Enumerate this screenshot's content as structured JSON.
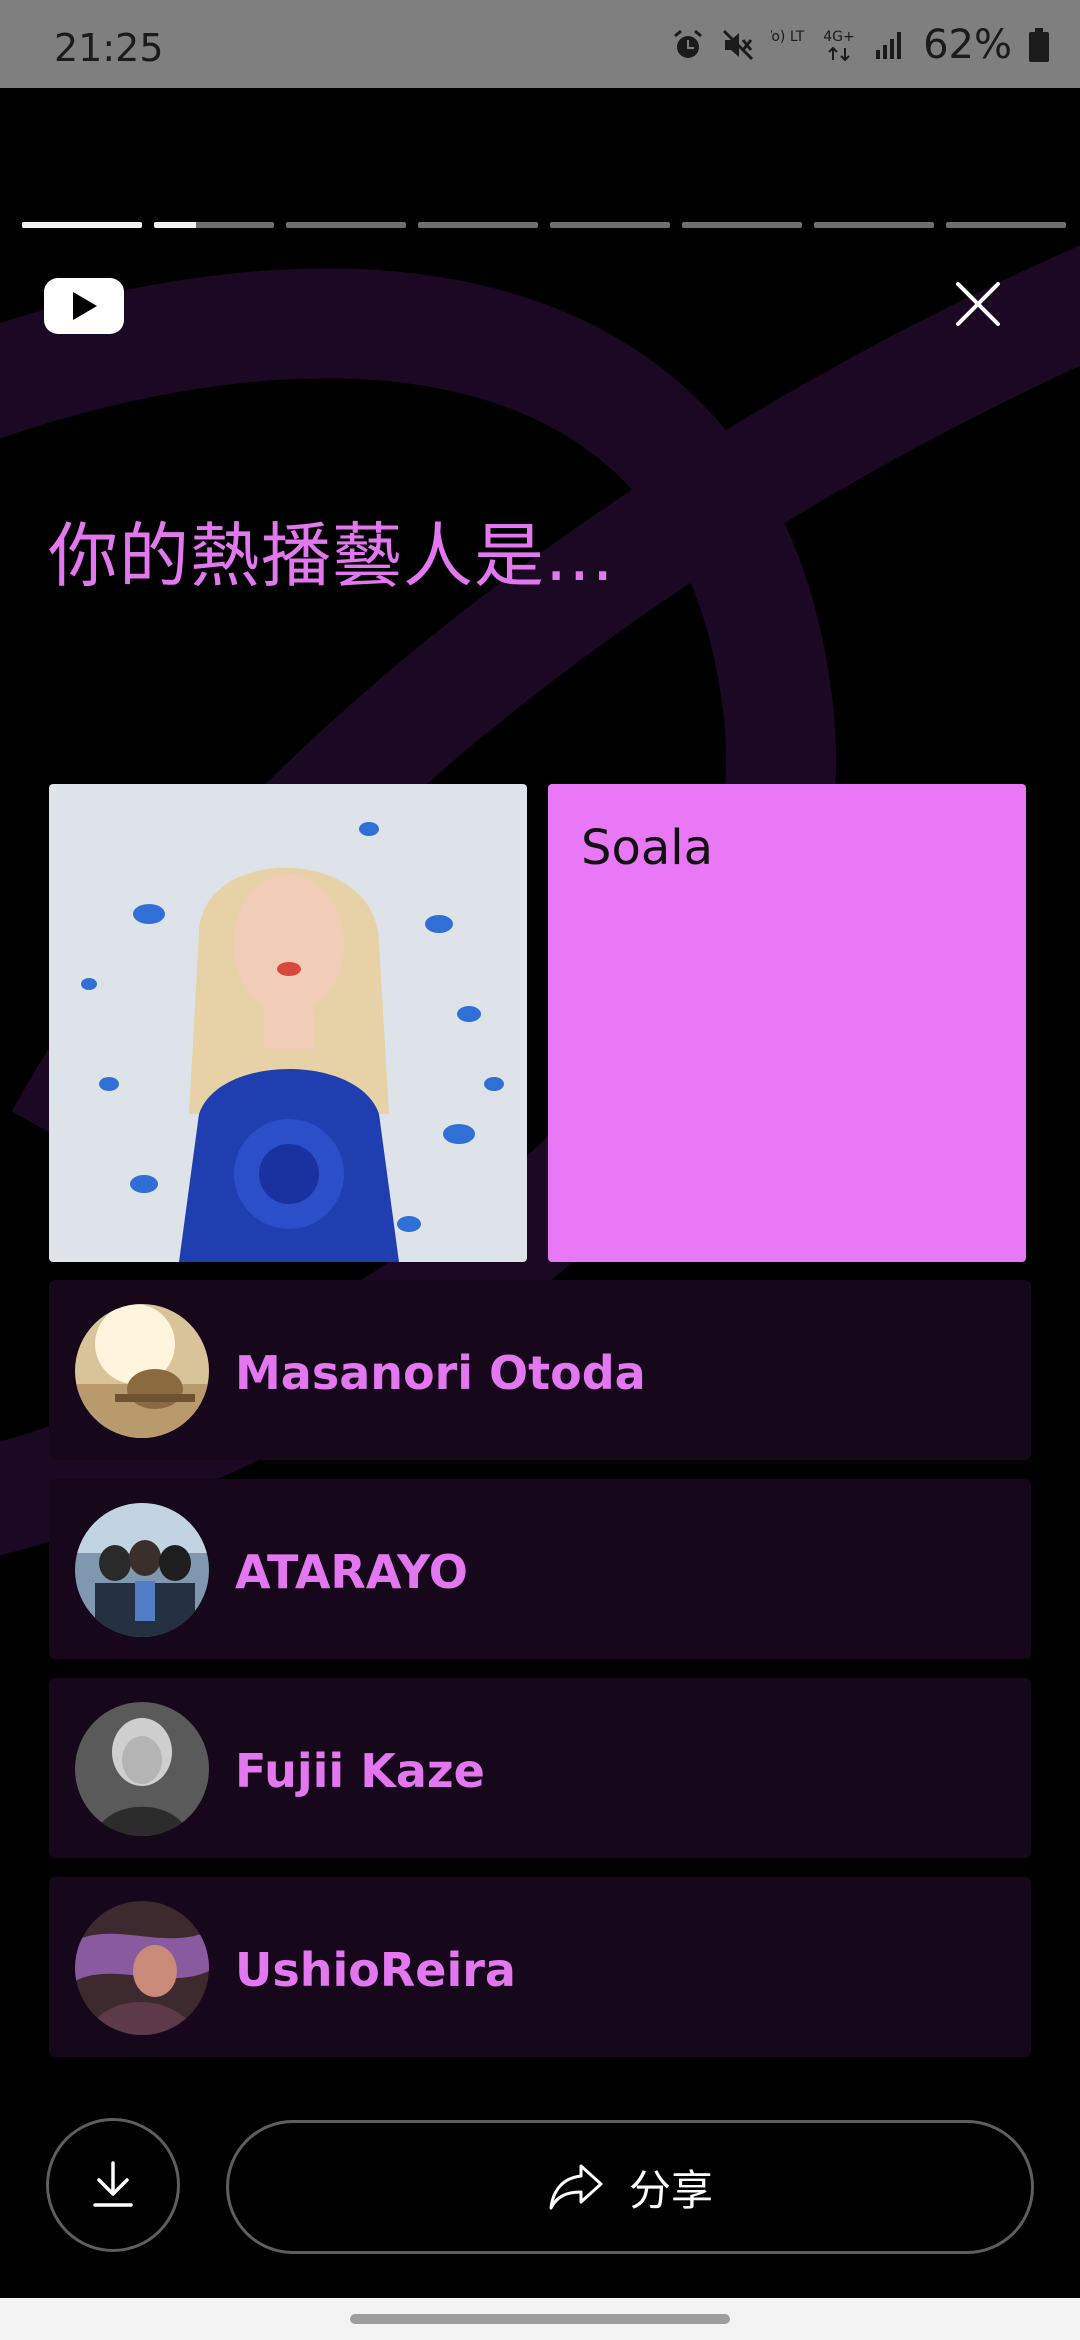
{
  "status_bar": {
    "time": "21:25",
    "battery": "62%",
    "icons": [
      "alarm-icon",
      "mute-icon",
      "volte-icon",
      "4g-icon",
      "signal-icon",
      "battery-icon"
    ],
    "volte_text": "Vo) LTE",
    "network_text": "4G+"
  },
  "story": {
    "progress": [
      1,
      0.35,
      0,
      0,
      0,
      0,
      0,
      0
    ],
    "headline": "你的熱播藝人是...",
    "top_artist": {
      "name": "Soala",
      "card_color": "#e878f5"
    },
    "artists": [
      {
        "name": "Masanori Otoda"
      },
      {
        "name": "ATARAYO"
      },
      {
        "name": "Fujii Kaze"
      },
      {
        "name": "UshioReira"
      }
    ],
    "accent_color": "#e277f0"
  },
  "actions": {
    "download_icon": "download-icon",
    "share_icon": "share-arrow-icon",
    "share_label": "分享"
  }
}
